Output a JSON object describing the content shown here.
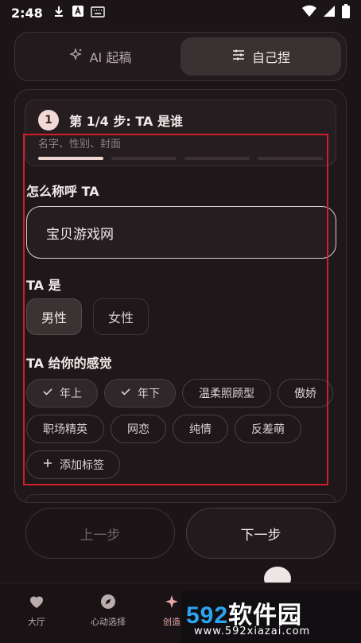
{
  "status_bar": {
    "time": "2:48"
  },
  "mode_toggle": {
    "ai_label": "AI 起稿",
    "manual_label": "自己捏"
  },
  "step": {
    "number": "1",
    "title": "第 1/4 步: TA 是谁",
    "subtitle": "名字、性别、封面",
    "progress_total": 4,
    "progress_done": 1
  },
  "name_section": {
    "label": "怎么称呼 TA",
    "value": "宝贝游戏网"
  },
  "gender_section": {
    "label": "TA 是",
    "options": [
      "男性",
      "女性"
    ],
    "selected": "男性"
  },
  "tags_section": {
    "label": "TA 给你的感觉",
    "tags": [
      "年上",
      "年下",
      "温柔照顾型",
      "傲娇",
      "职场精英",
      "网恋",
      "纯情",
      "反差萌"
    ],
    "selected": [
      "年上",
      "年下"
    ],
    "add_label": "添加标签"
  },
  "nav": {
    "prev_label": "上一步",
    "next_label": "下一步"
  },
  "tabbar": {
    "items": [
      "大厅",
      "心动选择",
      "创造"
    ]
  },
  "watermark": {
    "big_digits": "592",
    "big_cn": "软件园",
    "url": "www.592xiazai.com"
  },
  "colors": {
    "accent": "#efd6d2",
    "background": "#1c1517",
    "watermark_blue": "#2aa5f1"
  }
}
